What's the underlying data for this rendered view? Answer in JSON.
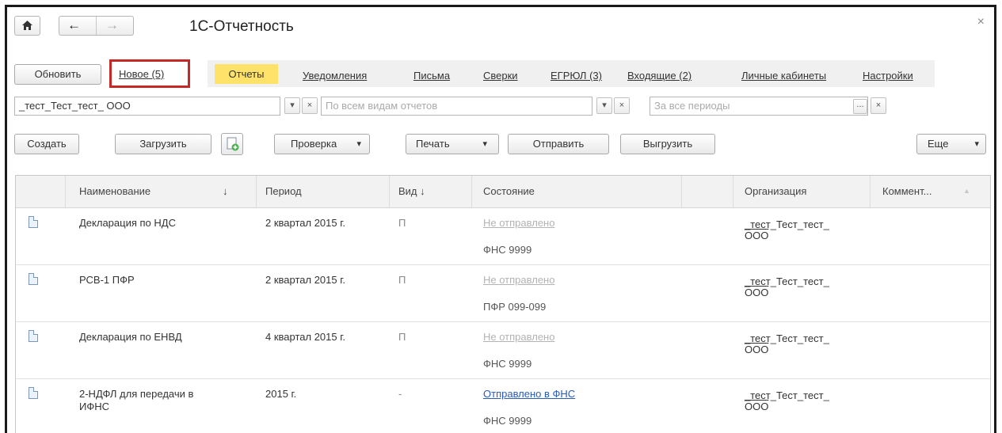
{
  "window": {
    "title": "1С-Отчетность",
    "close_glyph": "×"
  },
  "nav": {
    "home_glyph": "🏠",
    "back_glyph": "←",
    "forward_glyph": "→"
  },
  "toolbar": {
    "refresh": "Обновить",
    "new_link": "Новое (5)"
  },
  "tabs": [
    {
      "label": "Отчеты",
      "active": true
    },
    {
      "label": "Уведомления"
    },
    {
      "label": "Письма"
    },
    {
      "label": "Сверки"
    },
    {
      "label": "ЕГРЮЛ (3)"
    },
    {
      "label": "Входящие (2)"
    },
    {
      "label": "Личные кабинеты"
    },
    {
      "label": "Настройки"
    }
  ],
  "filters": {
    "organization": "_тест_Тест_тест_ ООО",
    "report_kind_placeholder": "По всем видам отчетов",
    "period_placeholder": "За все периоды",
    "dropdown_glyph": "▾",
    "clear_glyph": "×",
    "ellipsis_glyph": "..."
  },
  "actions": {
    "create": "Создать",
    "load": "Загрузить",
    "check": "Проверка",
    "print": "Печать",
    "send": "Отправить",
    "export": "Выгрузить",
    "more": "Еще"
  },
  "table": {
    "headers": [
      "Наименование",
      "↓",
      "Период",
      "Вид ↓",
      "Состояние",
      "Организация",
      "Коммент..."
    ],
    "rows": [
      {
        "name": "Декларация по НДС",
        "period": "2 квартал 2015 г.",
        "kind": "П",
        "status": "Не отправлено",
        "authority": "ФНС 9999",
        "org_line1": "_тест_Тест_тест_",
        "org_line2": "ООО",
        "sent": false
      },
      {
        "name": "РСВ-1 ПФР",
        "period": "2 квартал 2015 г.",
        "kind": "П",
        "status": "Не отправлено",
        "authority": "ПФР 099-099",
        "org_line1": "_тест_Тест_тест_",
        "org_line2": "ООО",
        "sent": false
      },
      {
        "name": "Декларация по ЕНВД",
        "period": "4 квартал 2015 г.",
        "kind": "П",
        "status": "Не отправлено",
        "authority": "ФНС 9999",
        "org_line1": "_тест_Тест_тест_",
        "org_line2": "ООО",
        "sent": false
      },
      {
        "name_line1": "2-НДФЛ для передачи в",
        "name_line2": "ИФНС",
        "period": "2015 г.",
        "kind": "-",
        "status": "Отправлено в ФНС",
        "authority": "ФНС 9999",
        "org_line1": "_тест_Тест_тест_",
        "org_line2": "ООО",
        "sent": true
      }
    ]
  },
  "colors": {
    "active_tab": "#ffe26a",
    "highlight_border": "#c62828",
    "link_blue": "#2a5bb8"
  }
}
